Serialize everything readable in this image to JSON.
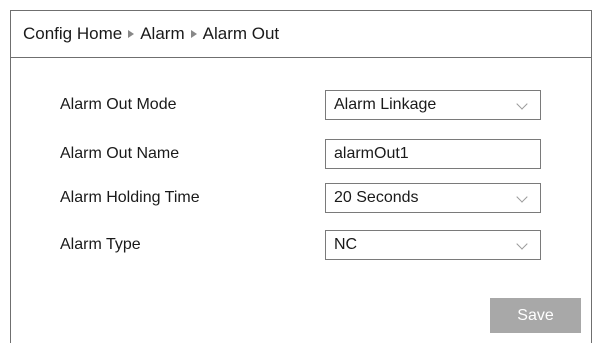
{
  "breadcrumb": {
    "items": [
      "Config Home",
      "Alarm",
      "Alarm Out"
    ]
  },
  "form": {
    "alarm_out_mode": {
      "label": "Alarm Out Mode",
      "value": "Alarm Linkage"
    },
    "alarm_out_name": {
      "label": "Alarm Out Name",
      "value": "alarmOut1"
    },
    "alarm_holding_time": {
      "label": "Alarm Holding Time",
      "value": "20 Seconds"
    },
    "alarm_type": {
      "label": "Alarm Type",
      "value": "NC"
    }
  },
  "actions": {
    "save_label": "Save"
  },
  "colors": {
    "border": "#6f6f6f",
    "save_button_bg": "#a8a8a8",
    "save_button_text": "#ffffff",
    "chevron": "#9a9a9a"
  },
  "icons": {
    "breadcrumb_separator": "triangle-right-icon",
    "dropdown": "chevron-down-icon"
  }
}
